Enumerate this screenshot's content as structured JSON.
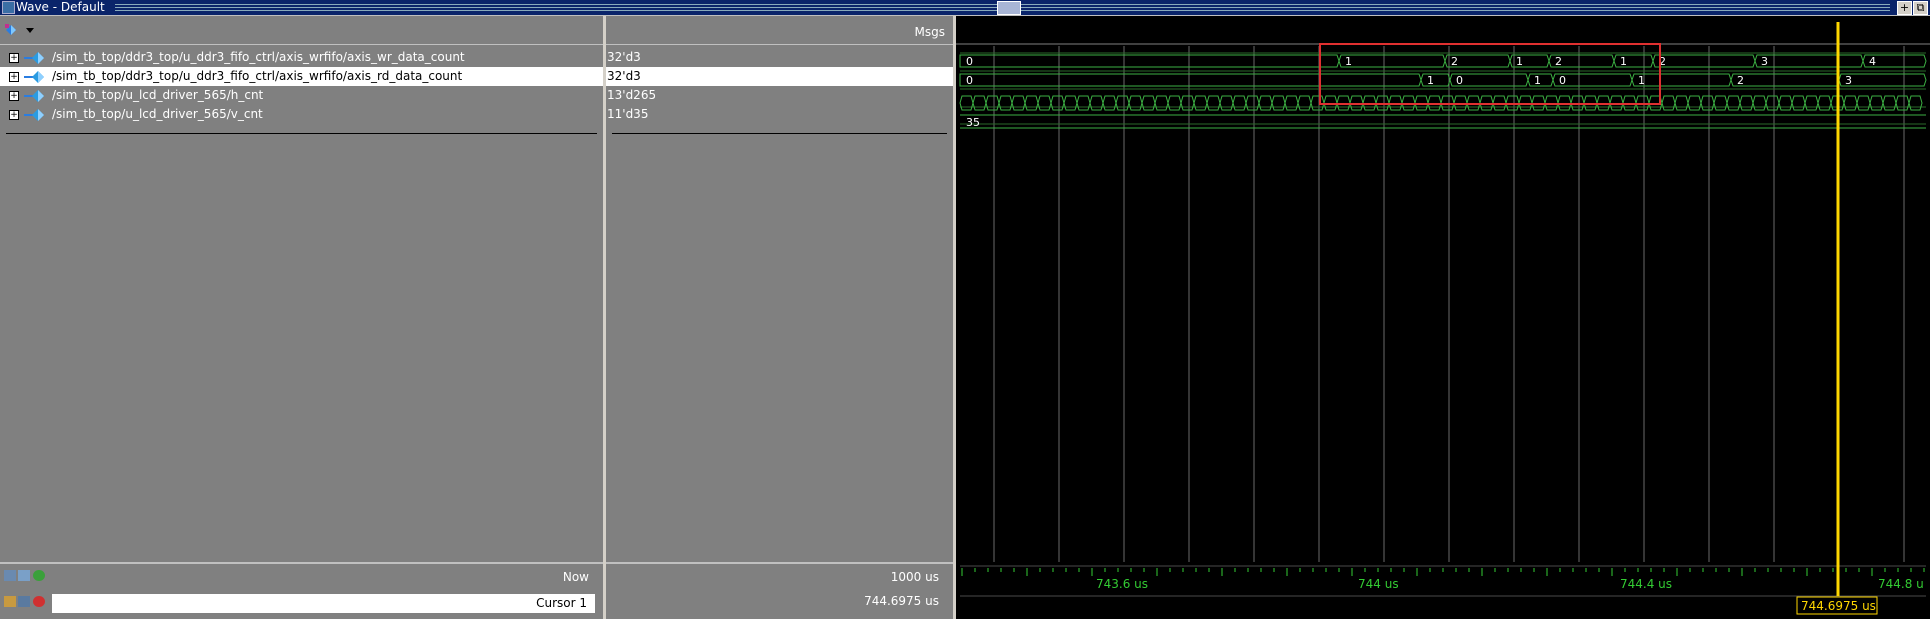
{
  "window": {
    "title": "Wave - Default",
    "buttons": [
      "+",
      "⧉"
    ]
  },
  "header": {
    "msgs_label": "Msgs"
  },
  "signals": [
    {
      "name": "/sim_tb_top/ddr3_top/u_ddr3_fifo_ctrl/axis_wrfifo/axis_wr_data_count",
      "value": "32'd3",
      "selected": false
    },
    {
      "name": "/sim_tb_top/ddr3_top/u_ddr3_fifo_ctrl/axis_wrfifo/axis_rd_data_count",
      "value": "32'd3",
      "selected": true
    },
    {
      "name": "/sim_tb_top/u_lcd_driver_565/h_cnt",
      "value": "13'd265",
      "selected": false
    },
    {
      "name": "/sim_tb_top/u_lcd_driver_565/v_cnt",
      "value": "11'd35",
      "selected": false
    }
  ],
  "waves": {
    "row0": {
      "initial": "0",
      "transitions": [
        [
          "1",
          1339
        ],
        [
          "2",
          1445
        ],
        [
          "1",
          1510
        ],
        [
          "2",
          1549
        ],
        [
          "1",
          1614
        ],
        [
          "2",
          1653
        ],
        [
          "3",
          1755
        ],
        [
          "4",
          1863
        ]
      ]
    },
    "row1": {
      "initial": "0",
      "transitions": [
        [
          "1",
          1421
        ],
        [
          "0",
          1450
        ],
        [
          "1",
          1528
        ],
        [
          "0",
          1553
        ],
        [
          "1",
          1632
        ],
        [
          "2",
          1731
        ],
        [
          "3",
          1839
        ]
      ]
    },
    "row3": {
      "initial": "35"
    }
  },
  "timeline": {
    "labels": [
      "743.6 us",
      "744 us",
      "744.4 us",
      "744.8 u"
    ],
    "cursor_time_label": "744.6975 us"
  },
  "bottom": {
    "now_label": "Now",
    "now_value": "1000 us",
    "cursor_label": "Cursor 1",
    "cursor_value": "744.6975 us"
  },
  "colors": {
    "wave": "#3cb043",
    "cursor": "#ffd700",
    "highlight": "#e03030",
    "timeline_text": "#33cc33"
  }
}
